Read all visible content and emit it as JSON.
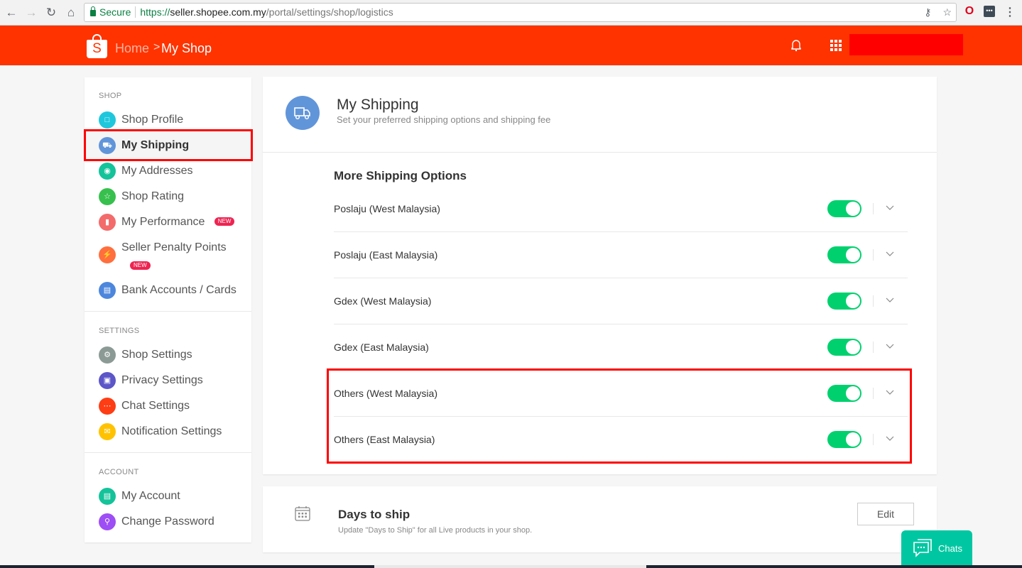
{
  "browser": {
    "secure_label": "Secure",
    "url_scheme": "https://",
    "url_host": "seller.shopee.com.my",
    "url_path": "/portal/settings/shop/logistics"
  },
  "header": {
    "logo_letter": "S",
    "breadcrumb_home": "Home",
    "breadcrumb_sep": ">",
    "breadcrumb_current": "My Shop",
    "brand_color": "#ff3300"
  },
  "sidebar": {
    "sections": [
      {
        "heading": "SHOP",
        "items": [
          {
            "label": "Shop Profile",
            "icon": "image-icon",
            "color": "#1fc7dd"
          },
          {
            "label": "My Shipping",
            "icon": "truck-icon",
            "color": "#6195da",
            "active": true
          },
          {
            "label": "My Addresses",
            "icon": "location-pin-icon",
            "color": "#14c39a"
          },
          {
            "label": "Shop Rating",
            "icon": "star-icon",
            "color": "#37c04d"
          },
          {
            "label": "My Performance",
            "icon": "bar-chart-icon",
            "color": "#f36b6b",
            "badge": "NEW"
          },
          {
            "label": "Seller Penalty Points",
            "icon": "lightning-icon",
            "color": "#ff6f3d",
            "badge": "NEW"
          },
          {
            "label": "Bank Accounts / Cards",
            "icon": "credit-card-icon",
            "color": "#4c87dd"
          }
        ]
      },
      {
        "heading": "SETTINGS",
        "items": [
          {
            "label": "Shop Settings",
            "icon": "gear-icon",
            "color": "#8c9a96"
          },
          {
            "label": "Privacy Settings",
            "icon": "lock-icon",
            "color": "#5c56c8"
          },
          {
            "label": "Chat Settings",
            "icon": "chat-bubble-icon",
            "color": "#fe3d15"
          },
          {
            "label": "Notification Settings",
            "icon": "mail-icon",
            "color": "#ffc200"
          }
        ]
      },
      {
        "heading": "ACCOUNT",
        "items": [
          {
            "label": "My Account",
            "icon": "id-card-icon",
            "color": "#14c39a"
          },
          {
            "label": "Change Password",
            "icon": "key-icon",
            "color": "#9d4ef5"
          }
        ]
      }
    ]
  },
  "main": {
    "title": "My Shipping",
    "subtitle": "Set your preferred shipping options and shipping fee",
    "section_title": "More Shipping Options",
    "options": [
      {
        "name": "Poslaju (West Malaysia)",
        "enabled": true
      },
      {
        "name": "Poslaju (East Malaysia)",
        "enabled": true
      },
      {
        "name": "Gdex (West Malaysia)",
        "enabled": true
      },
      {
        "name": "Gdex (East Malaysia)",
        "enabled": true
      },
      {
        "name": "Others (West Malaysia)",
        "enabled": true
      },
      {
        "name": "Others (East Malaysia)",
        "enabled": true
      }
    ],
    "toggle_on_color": "#00d16e"
  },
  "days_to_ship": {
    "title": "Days to ship",
    "subtitle": "Update \"Days to Ship\" for all Live products in your shop.",
    "edit_label": "Edit"
  },
  "chats": {
    "label": "Chats",
    "color": "#00c7a2"
  }
}
